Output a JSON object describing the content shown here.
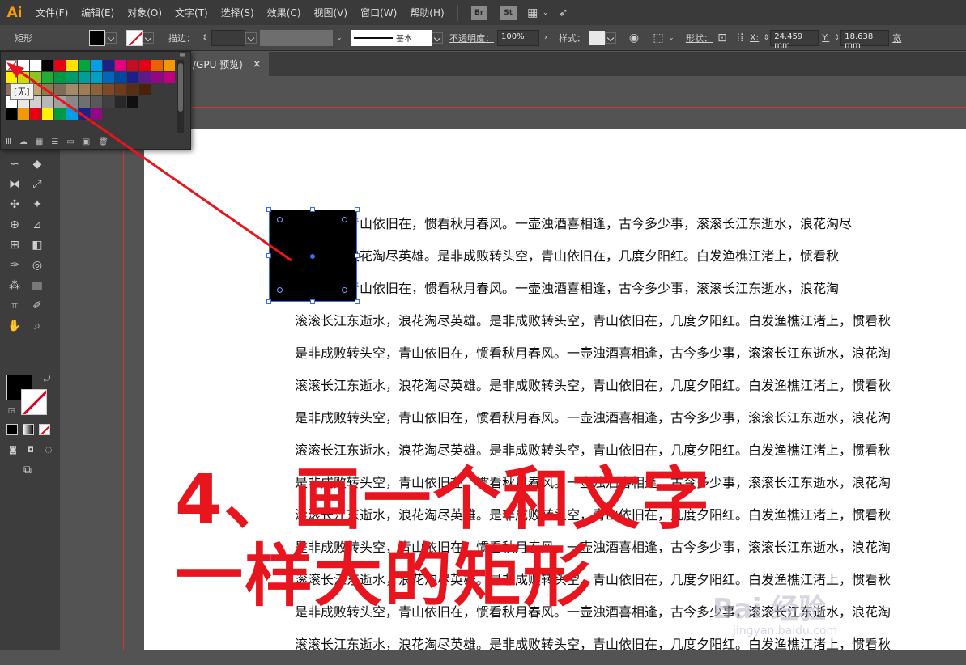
{
  "app": {
    "logo": "Ai",
    "brand_color": "#ff9a00"
  },
  "menu": {
    "items": [
      "文件(F)",
      "编辑(E)",
      "对象(O)",
      "文字(T)",
      "选择(S)",
      "效果(C)",
      "视图(V)",
      "窗口(W)",
      "帮助(H)"
    ],
    "br": "Br",
    "st": "St"
  },
  "control_bar": {
    "shape_name": "矩形",
    "stroke_label": "描边：",
    "stroke_style": "基本",
    "opacity_label": "不透明度：",
    "opacity_value": "100%",
    "style_label": "样式：",
    "shape_label": "形状：",
    "x_label": "X:",
    "x_value": "24.459 mm",
    "y_label": "Y:",
    "y_value": "18.638 mm",
    "w_label": "宽"
  },
  "document_tab": {
    "title": "/GPU 预览)",
    "close": "×"
  },
  "swatches": {
    "tooltip": "[无]",
    "rows": [
      [
        "#ffffff",
        "#ffffff",
        "#ffffff",
        "#000000",
        "#e60012",
        "#ffe100",
        "#00a73c",
        "#00a0e9",
        "#1d2088",
        "#e4007f",
        "#c30d23",
        "#e60012",
        "#eb6100",
        "#f39800"
      ],
      [
        "#fff100",
        "#cfdb00",
        "#8fc31f",
        "#22ac38",
        "#009944",
        "#009b6b",
        "#009e96",
        "#00a0c1",
        "#0068b7",
        "#00479d",
        "#1d2088",
        "#601986",
        "#920783",
        "#be0081"
      ],
      [
        "#8f6e5b",
        "#b28850",
        "#c4a571",
        "#8e7c4f",
        "#7e6b5a",
        "#a58a68",
        "#9f7c55",
        "#8c6239",
        "#7e4a26",
        "#6e3c19",
        "#5a2e13",
        "#4a220a"
      ],
      [
        "#ffffff",
        "#e8e8e8",
        "#d0d0d0",
        "#b8b8b8",
        "#a0a0a0",
        "#888888",
        "#707070",
        "#585858",
        "#404040",
        "#282828",
        "#101010"
      ],
      [
        "#000000",
        "#f39800",
        "#e60012",
        "#fff100",
        "#009944",
        "#00a0e9",
        "#1d2088",
        "#920783"
      ]
    ]
  },
  "annotation": {
    "line1": "4、画一个和文字",
    "line2": "一样大的矩形",
    "color": "#e8141e"
  },
  "document_text": {
    "lines": [
      "转头空，青山依旧在，惯看秋月春风。一壶浊酒喜相逢，古今多少事，滚滚长江东逝水，浪花淘尽",
      "东逝水，浪花淘尽英雄。是非成败转头空，青山依旧在，几度夕阳红。白发渔樵江渚上，惯看秋",
      "转头空，青山依旧在，惯看秋月春风。一壶浊酒喜相逢，古今多少事，滚滚长江东逝水，浪花淘",
      "滚滚长江东逝水，浪花淘尽英雄。是非成败转头空，青山依旧在，几度夕阳红。白发渔樵江渚上，惯看秋",
      "是非成败转头空，青山依旧在，惯看秋月春风。一壶浊酒喜相逢，古今多少事，滚滚长江东逝水，浪花淘",
      "滚滚长江东逝水，浪花淘尽英雄。是非成败转头空，青山依旧在，几度夕阳红。白发渔樵江渚上，惯看秋",
      "是非成败转头空，青山依旧在，惯看秋月春风。一壶浊酒喜相逢，古今多少事，滚滚长江东逝水，浪花淘",
      "滚滚长江东逝水，浪花淘尽英雄。是非成败转头空，青山依旧在，几度夕阳红。白发渔樵江渚上，惯看秋",
      "是非成败转头空，青山依旧在，惯看秋月春风。一壶浊酒喜相逢，古今多少事，滚滚长江东逝水，浪花淘",
      "滚滚长江东逝水，浪花淘尽英雄。是非成败转头空，青山依旧在，几度夕阳红。白发渔樵江渚上，惯看秋",
      "是非成败转头空，青山依旧在，惯看秋月春风。一壶浊酒喜相逢，古今多少事，滚滚长江东逝水，浪花淘",
      "滚滚长江东逝水，浪花淘尽英雄。是非成败转头空，青山依旧在，几度夕阳红。白发渔樵江渚上，惯看秋",
      "是非成败转头空，青山依旧在，惯看秋月春风。一壶浊酒喜相逢，古今多少事，滚滚长江东逝水，浪花淘",
      "滚滚长江东逝水，浪花淘尽英雄。是非成败转头空，青山依旧在，几度夕阳红。白发渔樵江渚上，惯看秋"
    ]
  },
  "watermark": {
    "brand": "Bai 经验",
    "url": "jingyan.baidu.com"
  }
}
